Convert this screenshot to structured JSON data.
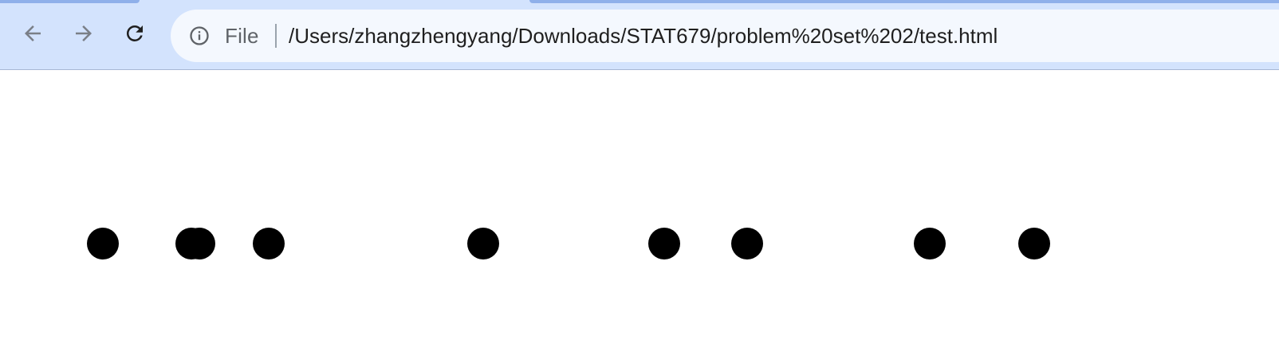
{
  "browser": {
    "nav": {
      "back_icon": "arrow-left-icon",
      "forward_icon": "arrow-right-icon",
      "reload_icon": "reload-icon"
    },
    "omnibox": {
      "info_icon": "info-icon",
      "scheme_label": "File",
      "url": "/Users/zhangzhengyang/Downloads/STAT679/problem%20set%202/test.html"
    },
    "colors": {
      "chrome_bg": "#d3e3fd",
      "omnibox_bg": "#f4f8fe",
      "icon_gray": "#5f6368"
    }
  },
  "page": {
    "circles": {
      "fill": "#000000",
      "count": 9
    }
  }
}
